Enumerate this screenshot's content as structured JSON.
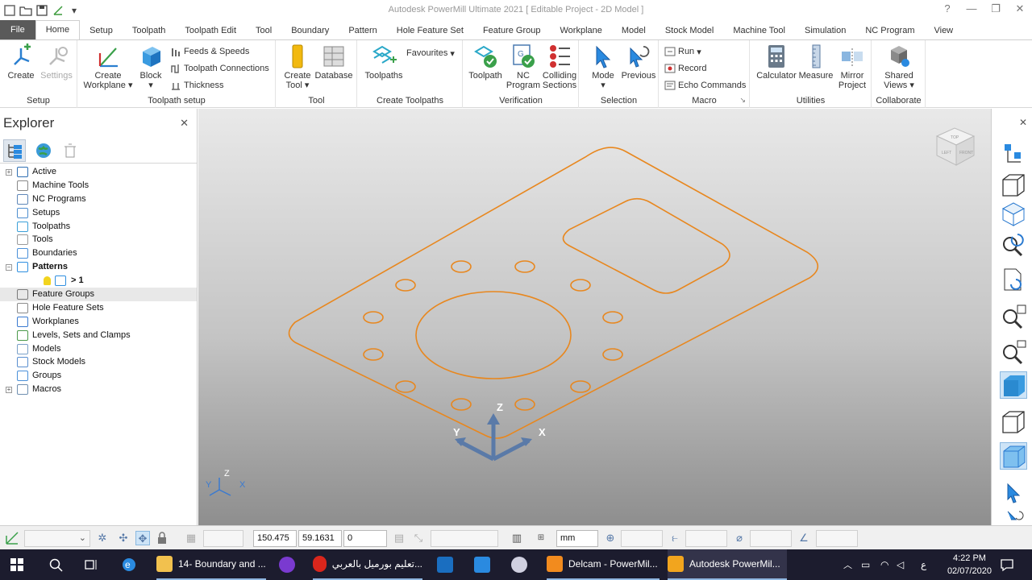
{
  "window": {
    "title": "Autodesk PowerMill Ultimate 2021   [ Editable Project - 2D Model ]"
  },
  "tabs": [
    "File",
    "Home",
    "Setup",
    "Toolpath",
    "Toolpath Edit",
    "Tool",
    "Boundary",
    "Pattern",
    "Hole Feature Set",
    "Feature Group",
    "Workplane",
    "Model",
    "Stock Model",
    "Machine Tool",
    "Simulation",
    "NC Program",
    "View"
  ],
  "ribbon": {
    "setup": {
      "label": "Setup",
      "create": "Create",
      "settings": "Settings"
    },
    "toolpath_setup": {
      "label": "Toolpath setup",
      "create_workplane_1": "Create",
      "create_workplane_2": "Workplane",
      "block": "Block",
      "feeds_speeds": "Feeds & Speeds",
      "toolpath_connections": "Toolpath Connections",
      "thickness": "Thickness"
    },
    "tool": {
      "label": "Tool",
      "create_tool_1": "Create",
      "create_tool_2": "Tool",
      "database": "Database"
    },
    "create_toolpaths": {
      "label": "Create Toolpaths",
      "toolpaths": "Toolpaths",
      "favourites": "Favourites"
    },
    "verification": {
      "label": "Verification",
      "toolpath": "Toolpath",
      "nc_program_1": "NC",
      "nc_program_2": "Program",
      "colliding_1": "Colliding",
      "colliding_2": "Sections"
    },
    "selection": {
      "label": "Selection",
      "mode": "Mode",
      "previous": "Previous"
    },
    "macro": {
      "label": "Macro",
      "run": "Run",
      "record": "Record",
      "echo": "Echo Commands"
    },
    "utilities": {
      "label": "Utilities",
      "calculator": "Calculator",
      "measure": "Measure",
      "mirror_1": "Mirror",
      "mirror_2": "Project"
    },
    "collaborate": {
      "label": "Collaborate",
      "shared_1": "Shared",
      "shared_2": "Views"
    }
  },
  "explorer": {
    "title": "Explorer",
    "items": [
      {
        "label": "Active",
        "expandable": true,
        "color": "#2f6fb3"
      },
      {
        "label": "Machine Tools",
        "expandable": false,
        "color": "#888888"
      },
      {
        "label": "NC Programs",
        "expandable": false,
        "color": "#5f87b8"
      },
      {
        "label": "Setups",
        "expandable": false,
        "color": "#4f8fd0"
      },
      {
        "label": "Toolpaths",
        "expandable": false,
        "color": "#3a9fd8"
      },
      {
        "label": "Tools",
        "expandable": false,
        "color": "#9a9a9a"
      },
      {
        "label": "Boundaries",
        "expandable": false,
        "color": "#4a90d9"
      },
      {
        "label": "Patterns",
        "expandable": true,
        "color": "#2f8fe0",
        "bold": true
      },
      {
        "label": "> 1",
        "expandable": false,
        "color": "#2f8fe0",
        "bold": true,
        "child": true
      },
      {
        "label": "Feature Groups",
        "expandable": false,
        "color": "#7a7a7a",
        "selected": true
      },
      {
        "label": "Hole Feature Sets",
        "expandable": false,
        "color": "#8a8a8a"
      },
      {
        "label": "Workplanes",
        "expandable": false,
        "color": "#3a7ad0"
      },
      {
        "label": "Levels, Sets and Clamps",
        "expandable": false,
        "color": "#4b9a4b"
      },
      {
        "label": "Models",
        "expandable": false,
        "color": "#7aa0c8"
      },
      {
        "label": "Stock Models",
        "expandable": false,
        "color": "#5a8fd0"
      },
      {
        "label": "Groups",
        "expandable": false,
        "color": "#4a90d9"
      },
      {
        "label": "Macros",
        "expandable": true,
        "color": "#6f8fb0"
      }
    ]
  },
  "viewport": {
    "axis_labels": {
      "z": "Z",
      "x": "X",
      "y": "Y"
    },
    "viewcube": {
      "top": "TOP",
      "left": "LEFT",
      "front": "FRONT"
    },
    "model_color": "#e8871e"
  },
  "statusbar": {
    "coord_x": "150.475",
    "coord_y": "59.1631",
    "coord_z": "0",
    "units": "mm"
  },
  "taskbar": {
    "items": [
      {
        "label": "14- Boundary and ...",
        "color": "#f2c14e"
      },
      {
        "label": "تعليم بورميل بالعربي...",
        "color": "#d9261c"
      },
      {
        "label": "Delcam - PowerMil...",
        "color": "#f28b1e"
      },
      {
        "label": "Autodesk PowerMil...",
        "color": "#f2a51e"
      }
    ],
    "lang": "ع",
    "time": "4:22 PM",
    "date": "02/07/2020"
  }
}
